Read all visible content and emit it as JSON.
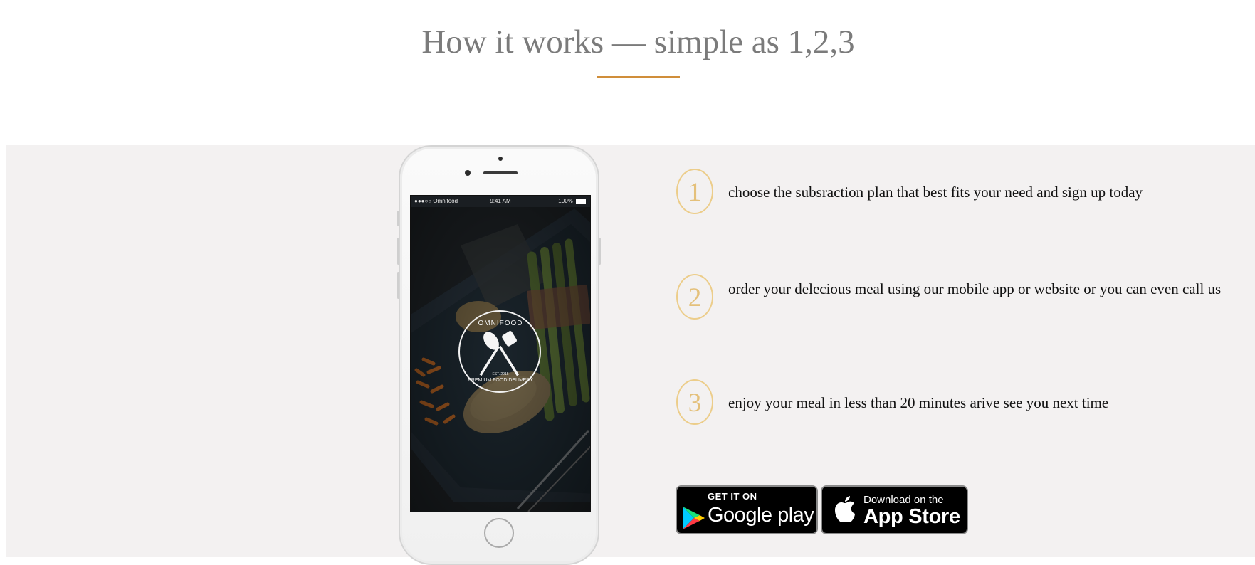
{
  "header": {
    "title": "How it works — simple as 1,2,3",
    "accent_color": "#d08e3a"
  },
  "phone": {
    "status": {
      "carrier": "●●●○○ Omnifood ",
      "time": "9:41 AM",
      "battery": "100%"
    },
    "logo": {
      "top_text": "OMNIFOOD",
      "bottom_text": "PREMIUM FOOD DELIVERY",
      "est": "EST. 2015",
      "icon": "spoon-fork-icon"
    }
  },
  "steps": [
    {
      "number": "1",
      "text": "choose the subsraction plan that best fits your need and sign up today"
    },
    {
      "number": "2",
      "text": "order your delecious meal using our mobile app or website or you can even call us"
    },
    {
      "number": "3",
      "text": "enjoy your meal in less than 20 minutes arive see you next time"
    }
  ],
  "store_badges": {
    "google": {
      "small": "GET IT ON",
      "large": "Google play",
      "icon": "play-triangle-icon"
    },
    "apple": {
      "small": "Download on the",
      "large": "App Store",
      "icon": "apple-icon"
    }
  },
  "colors": {
    "band_bg": "#f3f1f1",
    "step_circle": "#eccd8a",
    "step_number": "#e4c07a"
  }
}
